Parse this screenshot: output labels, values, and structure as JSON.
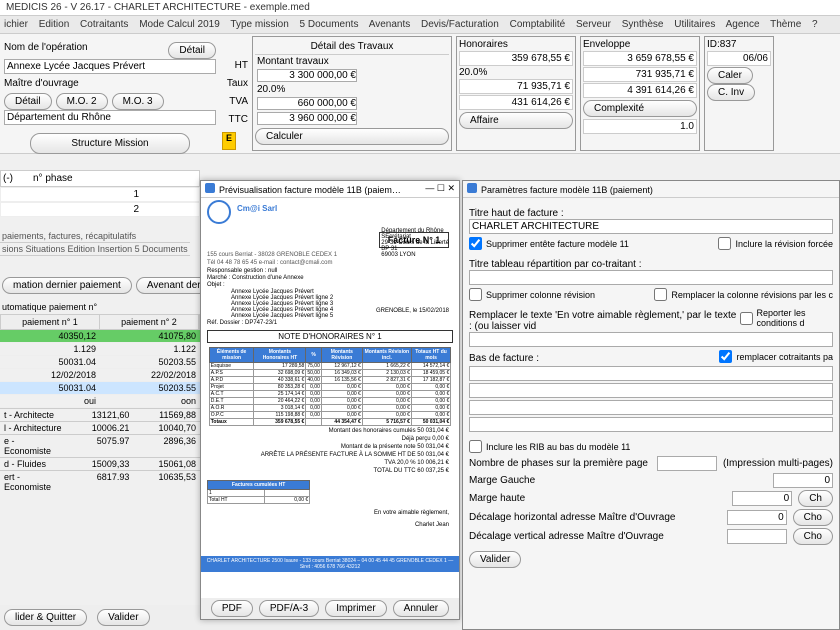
{
  "window_title": "MEDICIS 26 - V 26.17 - CHARLET ARCHITECTURE - exemple.med",
  "menubar": [
    "ichier",
    "Edition",
    "Cotraitants",
    "Mode Calcul 2019",
    "Type mission",
    "5 Documents",
    "Avenants",
    "Devis/Facturation",
    "Comptabilité",
    "Serveur",
    "Synthèse",
    "Utilitaires",
    "Agence",
    "Thème",
    "?"
  ],
  "op": {
    "nom_label": "Nom de l'opération",
    "detail_btn": "Détail",
    "nom_value": "Annexe Lycée Jacques Prévert",
    "mo_label": "Maître d'ouvrage",
    "mo_btns": [
      "Détail",
      "M.O. 2",
      "M.O. 3"
    ],
    "mo_value": "Département du Rhône",
    "struct_btn": "Structure Mission"
  },
  "labels": {
    "ht": "HT",
    "taux": "Taux",
    "tva": "TVA",
    "ttc": "TTC",
    "e": "E"
  },
  "travaux": {
    "hdr": "Détail des Travaux",
    "montant_label": "Montant travaux",
    "montant": "3 300 000,00 €",
    "taux": "20.0%",
    "tva": "660 000,00 €",
    "ttc": "3 960 000,00 €",
    "calc_btn": "Calculer"
  },
  "honoraires": {
    "title": "Honoraires",
    "ht": "359 678,55 €",
    "taux": "20.0%",
    "tva": "71 935,71 €",
    "ttc": "431 614,26 €",
    "affaire_btn": "Affaire"
  },
  "enveloppe": {
    "title": "Enveloppe",
    "ht": "3 659 678,55 €",
    "tva": "731 935,71 €",
    "ttc": "4 391 614,26 €",
    "cmplx_btn": "Complexité",
    "cmplx_val": "1.0"
  },
  "idbox": {
    "id": "ID:837",
    "date": "06/06",
    "calen_btn": "Caler",
    "cinv_btn": "C. Inv"
  },
  "phases": {
    "col1": "(-)",
    "col2": "n° phase",
    "rows": [
      "1",
      "2"
    ]
  },
  "paytabs": [
    "paiements, factures, récapitulatifs",
    "sions  Situations  Edition  Insertion  5 Documents"
  ],
  "paybtns": [
    "mation dernier paiement",
    "Avenant dernier paiement"
  ],
  "autopay_label": "utomatique paiement n°",
  "paycols": [
    "paiement n° 1",
    "paiement n° 2"
  ],
  "payrows": [
    {
      "c1": "40350,12",
      "c2": "41075,80",
      "cls": "green"
    },
    {
      "c1": "1.129",
      "c2": "1.122",
      "cls": ""
    },
    {
      "c1": "50031.04",
      "c2": "50203.55",
      "cls": ""
    },
    {
      "c1": "12/02/2018",
      "c2": "22/02/2018",
      "cls": ""
    },
    {
      "c1": "50031.04",
      "c2": "50203.55",
      "cls": "blue"
    },
    {
      "c1": "oui",
      "c2": "oon",
      "cls": ""
    }
  ],
  "lowrows": [
    {
      "n": "t - Architecte",
      "a": "13121,60",
      "b": "11569,88"
    },
    {
      "n": "l - Architecture",
      "a": "10006.21",
      "b": "10040,70"
    },
    {
      "n": "e - Economiste",
      "a": "5075.97",
      "b": "2896,36"
    },
    {
      "n": "d - Fluides",
      "a": "15009,33",
      "b": "15061,08"
    },
    {
      "n": "ert - Economiste",
      "a": "6817.93",
      "b": "10635,53"
    }
  ],
  "footer": {
    "vq": "lider & Quitter",
    "valider": "Valider"
  },
  "dlg1": {
    "title": "Prévisualisation facture modèle 11B (paiem…",
    "win_btns": [
      "—",
      "☐",
      "✕"
    ],
    "fact_hdr": "Facture N° 1",
    "company": "Cm@i Sarl",
    "addr1": "155 cours Berriat - 38028 GRENOBLE CEDEX 1",
    "addr2": "Tél 04 48 78 65 45 e-mail : contact@cmali.com",
    "client": [
      "Département du Rhône",
      "SEcrétariat",
      "29-31 Cours de la Liberté",
      "BP 31",
      "69003 LYON"
    ],
    "resp": "Responsable gestion : null",
    "marche": "Marché :  Construction d'une Annexe",
    "objet_lbl": "Objet :",
    "objets": [
      "Annexe Lycée Jacques Prévert",
      "Annexe Lycée Jacques Prévert ligne 2",
      "Annexe Lycée Jacques Prévert ligne 3",
      "Annexe Lycée Jacques Prévert ligne 4",
      "Annexe Lycée Jacques Prévert ligne 5"
    ],
    "ref": "Réf. Dossier : DP747-23/1",
    "date": "GRENOBLE, le 15/02/2018",
    "note_hdr": "NOTE D'HONORAIRES N° 1",
    "tbl_head": [
      "Éléments de mission",
      "Montants Honoraires HT",
      "%",
      "Montants Révision",
      "Montants Révision incl.",
      "Totaux HT du mois"
    ],
    "tbl_rows": [
      [
        "Esquisse",
        "17 289,58",
        "75,00",
        "12 967,12 €",
        "1 665,22 €",
        "14 572,14 €"
      ],
      [
        "A.P.S",
        "32 698,09 €",
        "50,00",
        "16 349,03 €",
        "2 130,03 €",
        "18 459,05 €"
      ],
      [
        "A.P.D",
        "40 338,61 €",
        "40,00",
        "16 135,56 €",
        "2 827,31 €",
        "17 182,87 €"
      ],
      [
        "Projet",
        "80 353,28 €",
        "0,00",
        "0,00 €",
        "0,00 €",
        "0,00 €"
      ],
      [
        "A.C.T",
        "25 174,14 €",
        "0,00",
        "0,00 €",
        "0,00 €",
        "0,00 €"
      ],
      [
        "D.E.T",
        "20 464,22 €",
        "0,00",
        "0,00 €",
        "0,00 €",
        "0,00 €"
      ],
      [
        "A.O.R",
        "3 018,14 €",
        "0,00",
        "0,00 €",
        "0,00 €",
        "0,00 €"
      ],
      [
        "O.P.C",
        "115 198,88 €",
        "0,00",
        "0,00 €",
        "0,00 €",
        "0,00 €"
      ]
    ],
    "tbl_tot": [
      "Totaux",
      "359 678,55 €",
      "",
      "44 354,47 €",
      "5 716,57 €",
      "50 031,04 €"
    ],
    "totals": [
      "Montant des honoraires cumulés      50 031,04 €",
      "Déjà perçu      0,00 €",
      "Montant de la présente note      50 031,04 €",
      "ARRÊTE LA PRÉSENTE FACTURE À LA SOMME HT DE      50 031,04 €",
      "TVA 20,0 %      10 006,21 €",
      "TOTAL DU TTC      60 037,25 €"
    ],
    "cumul_hdr": "Factures cumulées HT",
    "cumul_rows": [
      [
        "1",
        ""
      ]
    ],
    "cumul_tot": [
      "Total HT",
      "0,00 €"
    ],
    "sign1": "En votre aimable règlement,",
    "sign2": "Charlet Jean",
    "foot": "CHARLET ARCHITECTURE 2500 Isaure - 133 cours Berriat 38024 – 04 00 45 44 45 GRENOBLE CEDEX 1 — Siret : 4056 678 766 43212",
    "btns": [
      "PDF",
      "PDF/A-3",
      "Imprimer",
      "Annuler"
    ]
  },
  "dlg2": {
    "title": "Paramètres facture modèle 11B (paiement)",
    "titre_haut_lbl": "Titre haut de facture :",
    "titre_haut_val": "CHARLET ARCHITECTURE",
    "ck_supp11": "Supprimer entête facture modèle 11",
    "ck_inclrev": "Inclure la révision forcée",
    "titre_repart_lbl": "Titre tableau répartition par co-traitant :",
    "ck_suppcol": "Supprimer colonne révision",
    "ck_replcol": "Remplacer la colonne révisions par les c",
    "repl_lbl": "Remplacer le texte 'En votre aimable règlement,' par le texte :   (ou laisser vid",
    "ck_report": "Reporter les conditions d",
    "bas_lbl": "Bas de facture :",
    "ck_replco": "remplacer cotraitants pa",
    "ck_rib": "Inclure les RIB au bas du modèle 11",
    "nb_phases_lbl": "Nombre de phases sur la première page",
    "impr_multi": "(Impression multi-pages)",
    "marge_g_lbl": "Marge Gauche",
    "marge_g_val": "0",
    "marge_h_lbl": "Marge haute",
    "marge_h_val": "0",
    "dec_h_lbl": "Décalage horizontal adresse Maître d'Ouvrage",
    "dec_h_val": "0",
    "dec_v_lbl": "Décalage vertical adresse Maître d'Ouvrage",
    "cho_btn": "Cho",
    "ch_btn": "Ch",
    "valider": "Valider"
  }
}
